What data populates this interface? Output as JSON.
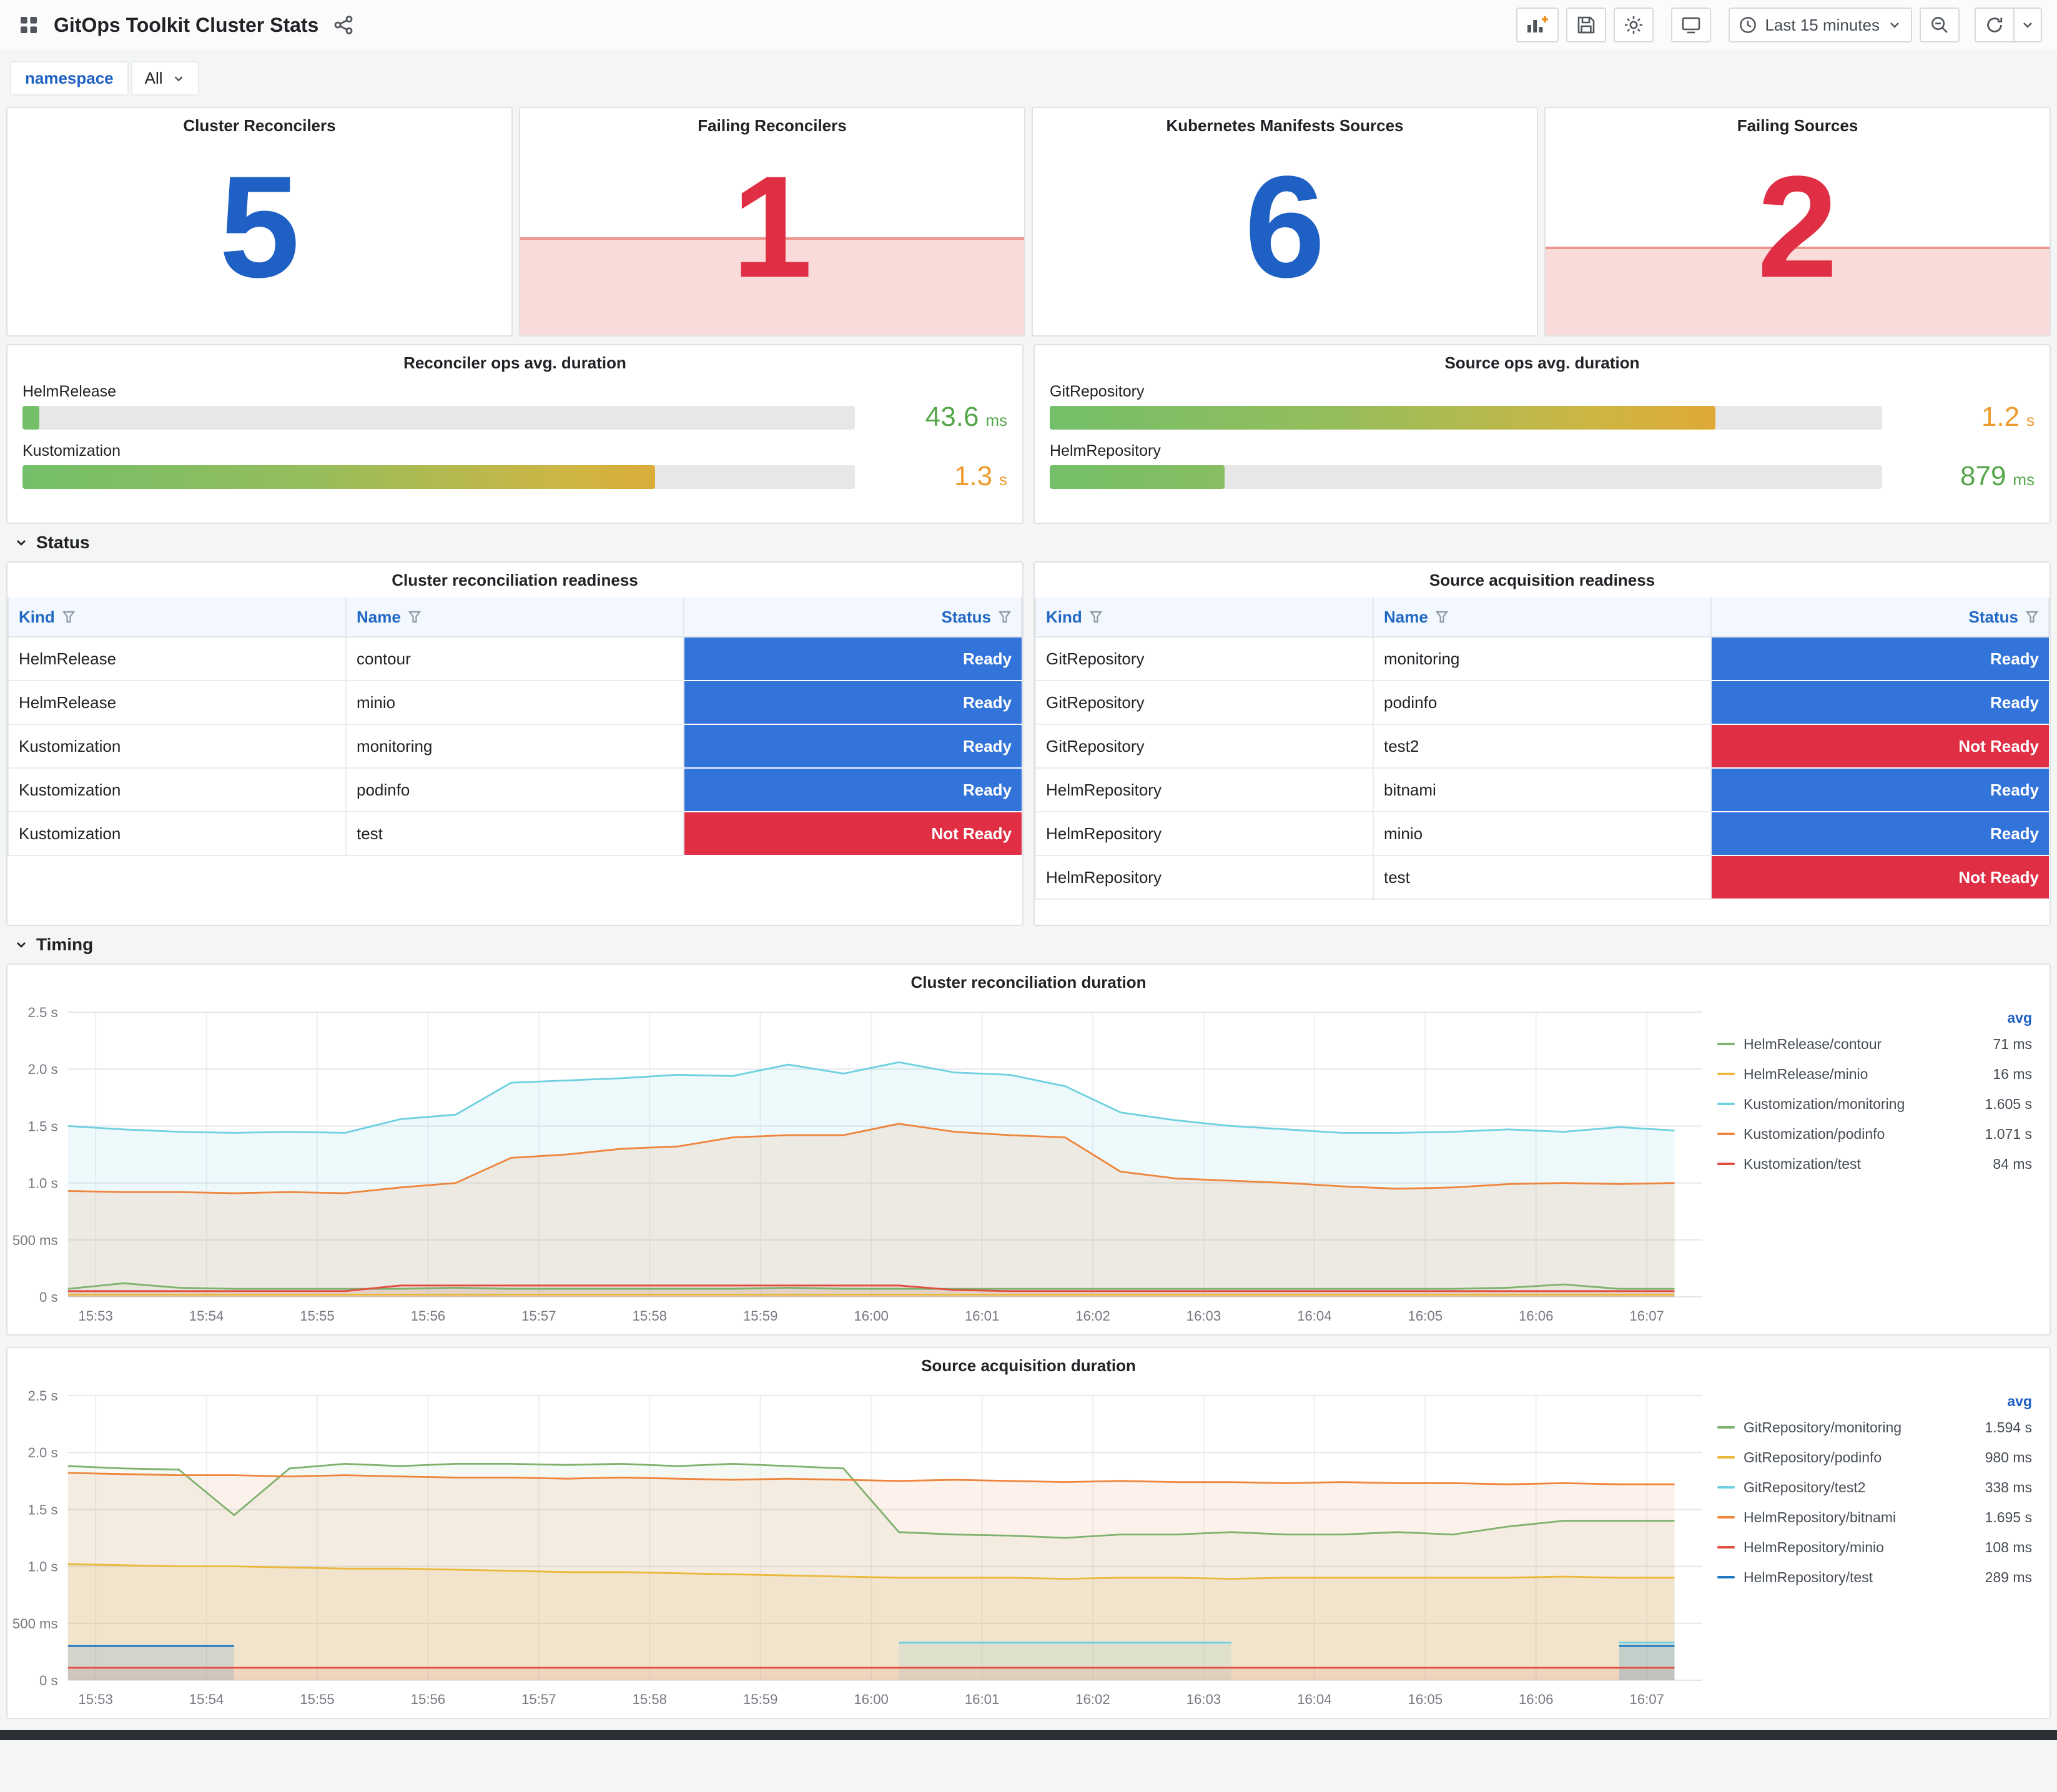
{
  "header": {
    "title": "GitOps Toolkit Cluster Stats",
    "toolbar": {
      "time_range_label": "Last 15 minutes"
    }
  },
  "variables": {
    "namespace_label": "namespace",
    "namespace_value": "All"
  },
  "colors": {
    "stat_blue": "#1F60C4",
    "stat_red": "#E02F44",
    "ready": "#3274D9",
    "not_ready": "#E02F44",
    "value_green": "#56A64B",
    "value_orange": "#ED9B2D"
  },
  "stats": [
    {
      "title": "Cluster Reconcilers",
      "value": "5",
      "state": "ok"
    },
    {
      "title": "Failing Reconcilers",
      "value": "1",
      "state": "alert",
      "fill_pct": 42
    },
    {
      "title": "Kubernetes Manifests Sources",
      "value": "6",
      "state": "ok"
    },
    {
      "title": "Failing Sources",
      "value": "2",
      "state": "alert",
      "fill_pct": 38
    }
  ],
  "gauges": [
    {
      "title": "Reconciler ops avg. duration",
      "rows": [
        {
          "label": "HelmRelease",
          "pct": 2,
          "value": "43.6",
          "unit": "ms",
          "value_color": "green"
        },
        {
          "label": "Kustomization",
          "pct": 76,
          "value": "1.3",
          "unit": "s",
          "value_color": "orange"
        }
      ]
    },
    {
      "title": "Source ops avg. duration",
      "rows": [
        {
          "label": "GitRepository",
          "pct": 80,
          "value": "1.2",
          "unit": "s",
          "value_color": "orange"
        },
        {
          "label": "HelmRepository",
          "pct": 21,
          "value": "879",
          "unit": "ms",
          "value_color": "green"
        }
      ]
    }
  ],
  "sections": {
    "status": "Status",
    "timing": "Timing"
  },
  "tables": [
    {
      "title": "Cluster reconciliation readiness",
      "columns": [
        "Kind",
        "Name",
        "Status"
      ],
      "rows": [
        [
          "HelmRelease",
          "contour",
          "Ready"
        ],
        [
          "HelmRelease",
          "minio",
          "Ready"
        ],
        [
          "Kustomization",
          "monitoring",
          "Ready"
        ],
        [
          "Kustomization",
          "podinfo",
          "Ready"
        ],
        [
          "Kustomization",
          "test",
          "Not Ready"
        ]
      ]
    },
    {
      "title": "Source acquisition readiness",
      "columns": [
        "Kind",
        "Name",
        "Status"
      ],
      "rows": [
        [
          "GitRepository",
          "monitoring",
          "Ready"
        ],
        [
          "GitRepository",
          "podinfo",
          "Ready"
        ],
        [
          "GitRepository",
          "test2",
          "Not Ready"
        ],
        [
          "HelmRepository",
          "bitnami",
          "Ready"
        ],
        [
          "HelmRepository",
          "minio",
          "Ready"
        ],
        [
          "HelmRepository",
          "test",
          "Not Ready"
        ]
      ]
    }
  ],
  "chart_data": [
    {
      "type": "line",
      "title": "Cluster reconciliation duration",
      "legend_header": "avg",
      "x_min": 952.75,
      "x_max": 967.5,
      "y_min": 0,
      "y_max": 2.5,
      "t0": 952.75,
      "dt": 0.5,
      "grid": true,
      "legend_position": "right",
      "y_ticks": [
        {
          "v": 0,
          "label": "0 s"
        },
        {
          "v": 0.5,
          "label": "500 ms"
        },
        {
          "v": 1,
          "label": "1.0 s"
        },
        {
          "v": 1.5,
          "label": "1.5 s"
        },
        {
          "v": 2,
          "label": "2.0 s"
        },
        {
          "v": 2.5,
          "label": "2.5 s"
        }
      ],
      "x_ticks": [
        {
          "v": 953,
          "label": "15:53"
        },
        {
          "v": 954,
          "label": "15:54"
        },
        {
          "v": 955,
          "label": "15:55"
        },
        {
          "v": 956,
          "label": "15:56"
        },
        {
          "v": 957,
          "label": "15:57"
        },
        {
          "v": 958,
          "label": "15:58"
        },
        {
          "v": 959,
          "label": "15:59"
        },
        {
          "v": 960,
          "label": "16:00"
        },
        {
          "v": 961,
          "label": "16:01"
        },
        {
          "v": 962,
          "label": "16:02"
        },
        {
          "v": 963,
          "label": "16:03"
        },
        {
          "v": 964,
          "label": "16:04"
        },
        {
          "v": 965,
          "label": "16:05"
        },
        {
          "v": 966,
          "label": "16:06"
        },
        {
          "v": 967,
          "label": "16:07"
        }
      ],
      "series": [
        {
          "name": "HelmRelease/contour",
          "avg": "71 ms",
          "color": "#7EB26D",
          "fill": 0.08,
          "values": [
            0.07,
            0.12,
            0.08,
            0.07,
            0.07,
            0.07,
            0.07,
            0.08,
            0.07,
            0.07,
            0.07,
            0.07,
            0.07,
            0.08,
            0.07,
            0.07,
            0.07,
            0.07,
            0.07,
            0.07,
            0.07,
            0.07,
            0.07,
            0.07,
            0.07,
            0.07,
            0.08,
            0.11,
            0.07,
            0.07
          ]
        },
        {
          "name": "HelmRelease/minio",
          "avg": "16 ms",
          "color": "#EAB839",
          "fill": 0.08,
          "values": [
            0.02,
            0.02,
            0.02,
            0.02,
            0.02,
            0.02,
            0.02,
            0.02,
            0.02,
            0.02,
            0.02,
            0.02,
            0.02,
            0.02,
            0.02,
            0.02,
            0.02,
            0.02,
            0.02,
            0.02,
            0.02,
            0.02,
            0.02,
            0.02,
            0.02,
            0.02,
            0.02,
            0.02,
            0.02,
            0.02
          ]
        },
        {
          "name": "Kustomization/monitoring",
          "avg": "1.605 s",
          "color": "#6ED0E0",
          "fill": 0.12,
          "values": [
            1.5,
            1.47,
            1.45,
            1.44,
            1.45,
            1.44,
            1.56,
            1.6,
            1.88,
            1.9,
            1.92,
            1.95,
            1.94,
            2.04,
            1.96,
            2.06,
            1.97,
            1.95,
            1.85,
            1.62,
            1.55,
            1.5,
            1.47,
            1.44,
            1.44,
            1.45,
            1.47,
            1.45,
            1.49,
            1.46
          ]
        },
        {
          "name": "Kustomization/podinfo",
          "avg": "1.071 s",
          "color": "#EF843C",
          "fill": 0.12,
          "values": [
            0.93,
            0.92,
            0.92,
            0.91,
            0.92,
            0.91,
            0.96,
            1.0,
            1.22,
            1.25,
            1.3,
            1.32,
            1.4,
            1.42,
            1.42,
            1.52,
            1.45,
            1.42,
            1.4,
            1.1,
            1.04,
            1.02,
            1.0,
            0.97,
            0.95,
            0.96,
            0.99,
            1.0,
            0.99,
            1.0
          ]
        },
        {
          "name": "Kustomization/test",
          "avg": "84 ms",
          "color": "#E24D42",
          "fill": 0.12,
          "values": [
            0.05,
            0.05,
            0.05,
            0.05,
            0.05,
            0.05,
            0.1,
            0.1,
            0.1,
            0.1,
            0.1,
            0.1,
            0.1,
            0.1,
            0.1,
            0.1,
            0.06,
            0.05,
            0.05,
            0.05,
            0.05,
            0.05,
            0.05,
            0.05,
            0.05,
            0.05,
            0.05,
            0.05,
            0.05,
            0.05
          ]
        }
      ]
    },
    {
      "type": "line",
      "title": "Source acquisition duration",
      "legend_header": "avg",
      "x_min": 952.75,
      "x_max": 967.5,
      "y_min": 0,
      "y_max": 2.5,
      "t0": 952.75,
      "dt": 0.5,
      "grid": true,
      "legend_position": "right",
      "y_ticks": [
        {
          "v": 0,
          "label": "0 s"
        },
        {
          "v": 0.5,
          "label": "500 ms"
        },
        {
          "v": 1,
          "label": "1.0 s"
        },
        {
          "v": 1.5,
          "label": "1.5 s"
        },
        {
          "v": 2,
          "label": "2.0 s"
        },
        {
          "v": 2.5,
          "label": "2.5 s"
        }
      ],
      "x_ticks": [
        {
          "v": 953,
          "label": "15:53"
        },
        {
          "v": 954,
          "label": "15:54"
        },
        {
          "v": 955,
          "label": "15:55"
        },
        {
          "v": 956,
          "label": "15:56"
        },
        {
          "v": 957,
          "label": "15:57"
        },
        {
          "v": 958,
          "label": "15:58"
        },
        {
          "v": 959,
          "label": "15:59"
        },
        {
          "v": 960,
          "label": "16:00"
        },
        {
          "v": 961,
          "label": "16:01"
        },
        {
          "v": 962,
          "label": "16:02"
        },
        {
          "v": 963,
          "label": "16:03"
        },
        {
          "v": 964,
          "label": "16:04"
        },
        {
          "v": 965,
          "label": "16:05"
        },
        {
          "v": 966,
          "label": "16:06"
        },
        {
          "v": 967,
          "label": "16:07"
        }
      ],
      "series": [
        {
          "name": "GitRepository/monitoring",
          "avg": "1.594 s",
          "color": "#7EB26D",
          "fill": 0.08,
          "values": [
            1.88,
            1.86,
            1.85,
            1.45,
            1.86,
            1.9,
            1.88,
            1.9,
            1.9,
            1.89,
            1.9,
            1.88,
            1.9,
            1.88,
            1.86,
            1.3,
            1.28,
            1.27,
            1.25,
            1.28,
            1.28,
            1.3,
            1.28,
            1.28,
            1.3,
            1.28,
            1.35,
            1.4,
            1.4,
            1.4
          ]
        },
        {
          "name": "GitRepository/podinfo",
          "avg": "980 ms",
          "color": "#EAB839",
          "fill": 0.12,
          "values": [
            1.02,
            1.01,
            1.0,
            1.0,
            0.99,
            0.98,
            0.98,
            0.97,
            0.96,
            0.95,
            0.95,
            0.94,
            0.93,
            0.92,
            0.91,
            0.9,
            0.9,
            0.9,
            0.89,
            0.9,
            0.9,
            0.89,
            0.9,
            0.9,
            0.9,
            0.9,
            0.9,
            0.91,
            0.9,
            0.9
          ]
        },
        {
          "name": "GitRepository/test2",
          "avg": "338 ms",
          "color": "#6ED0E0",
          "fill": 0.15,
          "values": [
            null,
            null,
            null,
            null,
            null,
            null,
            null,
            null,
            null,
            null,
            null,
            null,
            null,
            null,
            null,
            0.33,
            0.33,
            0.33,
            0.33,
            0.33,
            0.33,
            0.33,
            null,
            null,
            null,
            null,
            null,
            null,
            0.33,
            0.33
          ]
        },
        {
          "name": "HelmRepository/bitnami",
          "avg": "1.695 s",
          "color": "#EF843C",
          "fill": 0.1,
          "values": [
            1.82,
            1.81,
            1.8,
            1.8,
            1.79,
            1.8,
            1.79,
            1.78,
            1.78,
            1.77,
            1.78,
            1.77,
            1.76,
            1.77,
            1.76,
            1.75,
            1.76,
            1.75,
            1.74,
            1.75,
            1.74,
            1.74,
            1.73,
            1.74,
            1.73,
            1.73,
            1.72,
            1.73,
            1.72,
            1.72
          ]
        },
        {
          "name": "HelmRepository/minio",
          "avg": "108 ms",
          "color": "#E24D42",
          "fill": 0.1,
          "values": [
            0.11,
            0.11,
            0.11,
            0.11,
            0.11,
            0.11,
            0.11,
            0.11,
            0.11,
            0.11,
            0.11,
            0.11,
            0.11,
            0.11,
            0.11,
            0.11,
            0.11,
            0.11,
            0.11,
            0.11,
            0.11,
            0.11,
            0.11,
            0.11,
            0.11,
            0.11,
            0.11,
            0.11,
            0.11,
            0.11
          ]
        },
        {
          "name": "HelmRepository/test",
          "avg": "289 ms",
          "color": "#1F78C1",
          "fill": 0.15,
          "values": [
            0.3,
            0.3,
            0.3,
            0.3,
            null,
            null,
            null,
            null,
            null,
            null,
            null,
            null,
            null,
            null,
            null,
            null,
            null,
            null,
            null,
            null,
            null,
            null,
            null,
            null,
            null,
            null,
            null,
            null,
            0.3,
            0.3
          ]
        }
      ]
    }
  ]
}
